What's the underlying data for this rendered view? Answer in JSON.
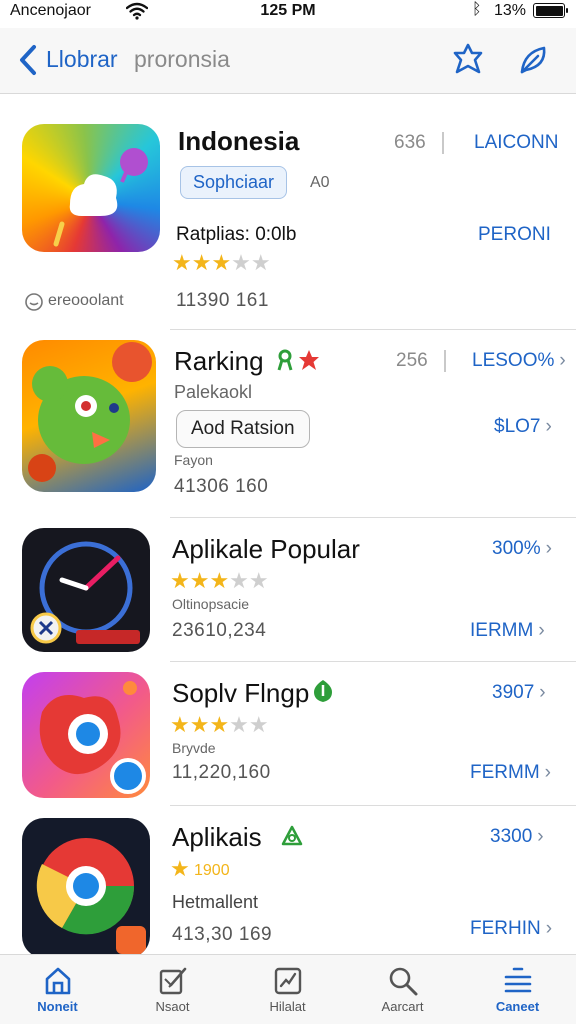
{
  "status_bar": {
    "carrier": "Ancenojaor",
    "time": "125 PM",
    "battery_text": "13%"
  },
  "nav": {
    "back_label": "Llobrar",
    "title": "proronsia"
  },
  "apps": [
    {
      "name": "Indonesia",
      "metric": "636",
      "action": "LAICONN",
      "badge": "Sophciaar",
      "badge_note": "A0",
      "rating_label": "Ratplias: 0:0lb",
      "price": "PERONI",
      "stars": 3,
      "developer": "ereooolant",
      "count": "11390 161"
    },
    {
      "name": "Rarking",
      "metric": "256",
      "action": "LESOO%",
      "subtitle": "Palekaokl",
      "button": "Aod Ratsion",
      "price": "$LO7",
      "small_label": "Fayon",
      "count": "41306 160"
    },
    {
      "name": "Aplikale Popular",
      "price": "300%",
      "stars": 3,
      "subtitle": "Oltinopsacie",
      "count": "23610,234",
      "action": "IERMM"
    },
    {
      "name": "Soplv Flngp",
      "price": "3907",
      "stars": 3,
      "subtitle": "Bryvde",
      "count": "11,220,160",
      "action": "FERMM"
    },
    {
      "name": "Aplikais",
      "price": "3300",
      "rating_text": "1900",
      "subtitle": "Hetmallent",
      "count": "413,30 169",
      "action": "FERHIN"
    }
  ],
  "tabs": [
    {
      "label": "Noneit",
      "icon": "home-icon"
    },
    {
      "label": "Nsaot",
      "icon": "edit-icon"
    },
    {
      "label": "Hilalat",
      "icon": "chart-icon"
    },
    {
      "label": "Aarcart",
      "icon": "search-icon"
    },
    {
      "label": "Caneet",
      "icon": "menu-icon"
    }
  ],
  "colors": {
    "accent": "#1f64c6",
    "star": "#f3b51a",
    "separator": "#dcdcdc"
  }
}
